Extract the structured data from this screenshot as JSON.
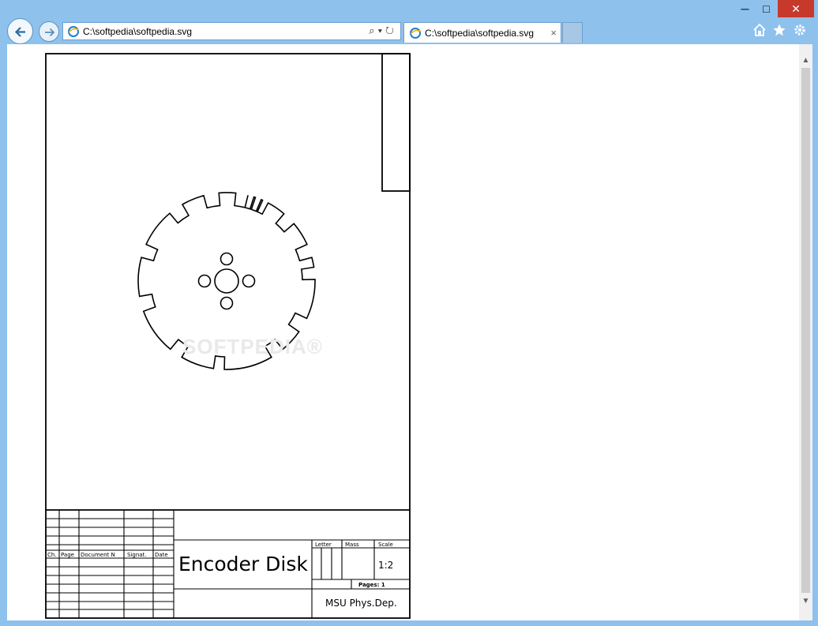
{
  "browser": {
    "address": "C:\\softpedia\\softpedia.svg",
    "tab_title": "C:\\softpedia\\softpedia.svg",
    "tab_close": "×",
    "window": {
      "minimize": "─",
      "maximize": "□",
      "close": "✕"
    },
    "address_tools": "⌕▾↻",
    "commands": [
      "home-icon",
      "favorites-icon",
      "settings-icon"
    ],
    "accent_color": "#8ec1ec"
  },
  "drawing": {
    "title": "Encoder Disk",
    "org": "MSU Phys.Dep.",
    "scale_label": "Scale",
    "scale_value": "1:2",
    "letter_label": "Letter",
    "mass_label": "Mass",
    "pages_label": "Pages: 1",
    "revision_columns": [
      "Ch.",
      "Page",
      "Document N",
      "Signat.",
      "Date"
    ]
  },
  "watermark": "SOFTPEDIA®"
}
